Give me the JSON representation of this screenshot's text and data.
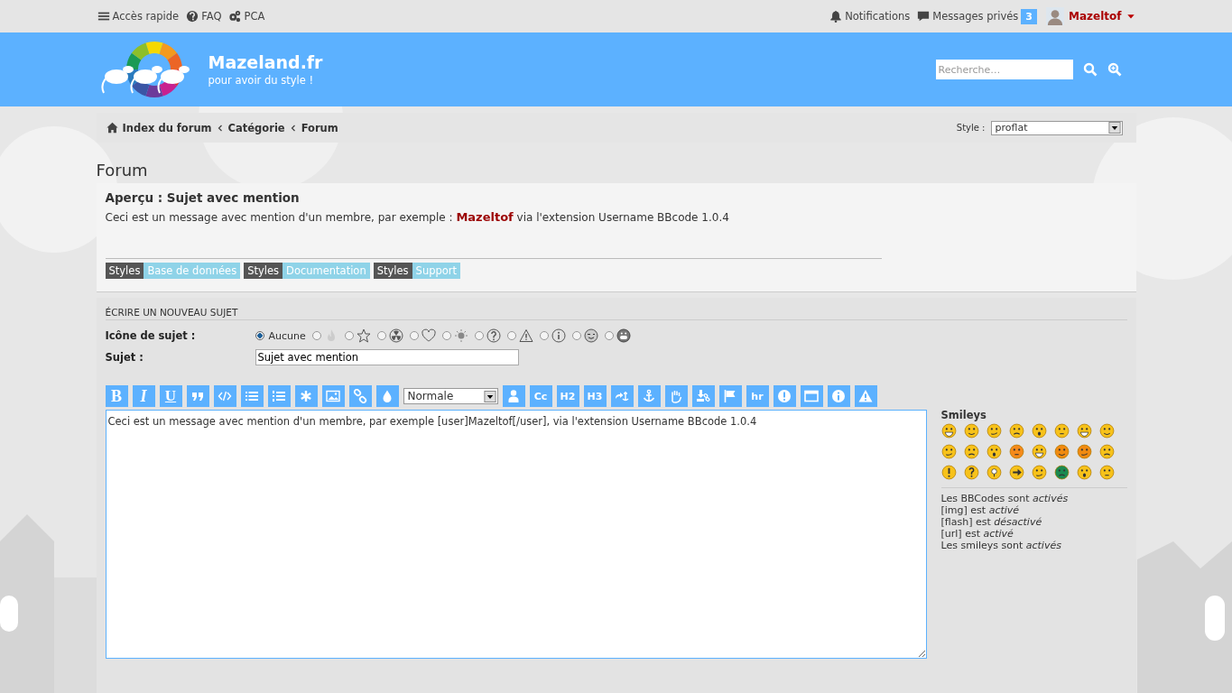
{
  "top_bar": {
    "left": [
      {
        "label": "Accès rapide"
      },
      {
        "label": "FAQ"
      },
      {
        "label": "PCA"
      }
    ],
    "notifications": "Notifications",
    "messages": "Messages privés",
    "messages_count": "3",
    "user": "Mazeltof"
  },
  "header": {
    "site_title": "Mazeland.fr",
    "tagline": "pour avoir du style !",
    "search": {
      "placeholder": "Recherche…"
    }
  },
  "breadcrumbs": [
    "Index du forum",
    "Catégorie",
    "Forum"
  ],
  "style_select": {
    "label": "Style :",
    "value": "proflat"
  },
  "page_title": "Forum",
  "preview": {
    "title": "Aperçu : Sujet avec mention",
    "body": "Ceci est un message avec mention d'un membre, par exemple : **Mazeltof** via l'extension Username BBcode 1.0.4",
    "links": [
      {
        "tag": "Styles",
        "label": "Base de données"
      },
      {
        "tag": "Styles",
        "label": "Documentation"
      },
      {
        "tag": "Styles",
        "label": "Support"
      }
    ]
  },
  "form": {
    "title": "ÉCRIRE UN NOUVEAU SUJET",
    "icon_label": "Icône de sujet :",
    "icons": [
      {
        "label": "Aucune",
        "selected": true
      },
      {
        "selected": false
      },
      {
        "selected": false
      },
      {
        "selected": false
      },
      {
        "selected": false
      },
      {
        "selected": false
      },
      {
        "selected": false
      },
      {
        "selected": false
      },
      {
        "selected": false
      },
      {
        "selected": false
      },
      {
        "selected": false
      }
    ],
    "subject_label": "Sujet :",
    "subject_value": "Sujet avec mention",
    "toolbar": [
      {
        "kind": "text",
        "label": "B"
      },
      {
        "kind": "text",
        "label": "I"
      },
      {
        "kind": "text",
        "label": "U"
      },
      {
        "kind": "icon"
      },
      {
        "kind": "icon"
      },
      {
        "kind": "icon"
      },
      {
        "kind": "icon"
      },
      {
        "kind": "icon"
      },
      {
        "kind": "icon"
      },
      {
        "kind": "icon"
      },
      {
        "kind": "icon"
      },
      {
        "kind": "select",
        "label": "Normale"
      },
      {
        "kind": "icon"
      },
      {
        "kind": "text",
        "label": "Cc"
      },
      {
        "kind": "text",
        "label": "H2"
      },
      {
        "kind": "text",
        "label": "H3"
      },
      {
        "kind": "icon"
      },
      {
        "kind": "icon"
      },
      {
        "kind": "icon"
      },
      {
        "kind": "icon"
      },
      {
        "kind": "icon"
      },
      {
        "kind": "text",
        "label": "hr"
      },
      {
        "kind": "icon"
      },
      {
        "kind": "icon"
      },
      {
        "kind": "icon"
      },
      {
        "kind": "icon"
      }
    ],
    "message": "Ceci est un message avec mention d'un membre, par exemple [user]Mazeltof[/user], via l'extension Username BBcode 1.0.4",
    "smileys_title": "Smileys",
    "options": [
      "Les BBCodes sont *activés*",
      "[img] est *activé*",
      "[flash] est *désactivé*",
      "[url] est *activé*",
      "Les smileys sont *activés*"
    ]
  }
}
